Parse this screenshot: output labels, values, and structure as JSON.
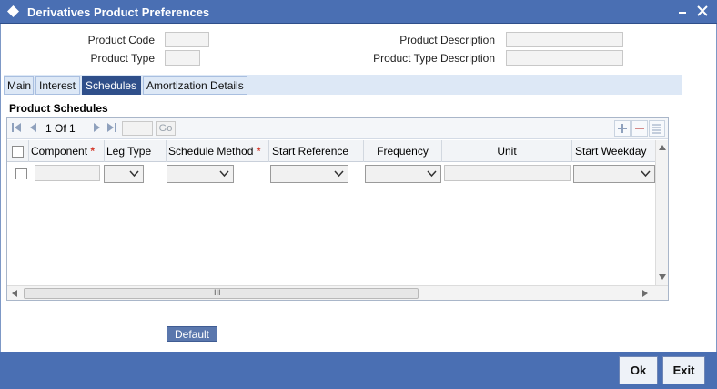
{
  "window": {
    "title": "Derivatives Product Preferences"
  },
  "header": {
    "product_code_label": "Product Code",
    "product_type_label": "Product Type",
    "product_description_label": "Product Description",
    "product_type_description_label": "Product Type Description"
  },
  "tabs": [
    {
      "label": "Main"
    },
    {
      "label": "Interest"
    },
    {
      "label": "Schedules",
      "active": true
    },
    {
      "label": "Amortization Details"
    }
  ],
  "section": {
    "title": "Product Schedules"
  },
  "pager": {
    "text": "1 Of 1",
    "go_label": "Go"
  },
  "grid": {
    "columns": [
      {
        "label": "Component",
        "required": true
      },
      {
        "label": "Leg Type",
        "required": false
      },
      {
        "label": "Schedule Method",
        "required": true
      },
      {
        "label": "Start Reference",
        "required": false
      },
      {
        "label": "Frequency",
        "required": false
      },
      {
        "label": "Unit",
        "required": false
      },
      {
        "label": "Start Weekday",
        "required": false
      }
    ],
    "required_marker": "*",
    "scroll_grip": "III"
  },
  "buttons": {
    "default": "Default",
    "ok": "Ok",
    "exit": "Exit"
  },
  "colors": {
    "titlebar": "#4a6fb3",
    "active_tab": "#2f4f8a",
    "required": "#d43a2c"
  }
}
